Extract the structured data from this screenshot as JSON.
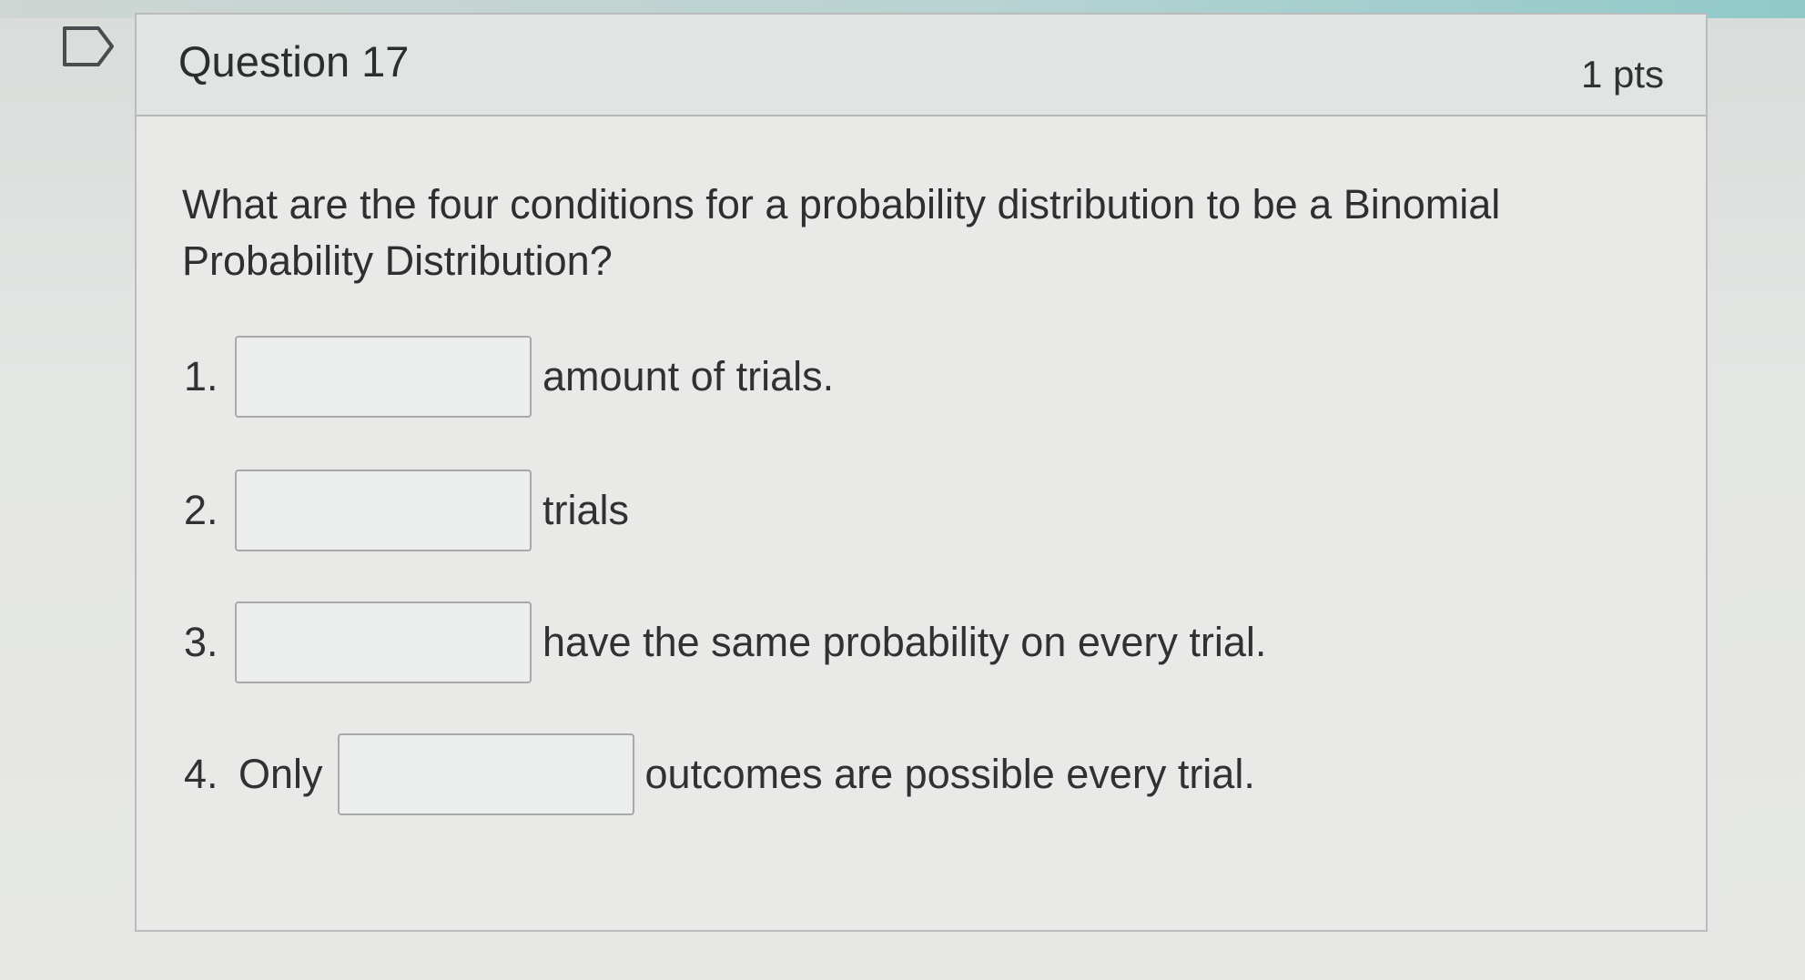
{
  "question": {
    "title": "Question 17",
    "points": "1 pts",
    "prompt": "What are the four conditions for a probability distribution to be a Binomial Probability Distribution?"
  },
  "items": [
    {
      "number": "1.",
      "prefix": "",
      "value": "",
      "suffix": "amount of trials."
    },
    {
      "number": "2.",
      "prefix": "",
      "value": "",
      "suffix": "trials"
    },
    {
      "number": "3.",
      "prefix": "",
      "value": "",
      "suffix": "have the same probability on every trial."
    },
    {
      "number": "4.",
      "prefix": "Only",
      "value": "",
      "suffix": "outcomes are possible every trial."
    }
  ],
  "icons": {
    "flag": "flag-outline-icon"
  },
  "colors": {
    "card_border": "#b9bcba",
    "text": "#2d2f30",
    "input_border": "#a6a8a9"
  }
}
